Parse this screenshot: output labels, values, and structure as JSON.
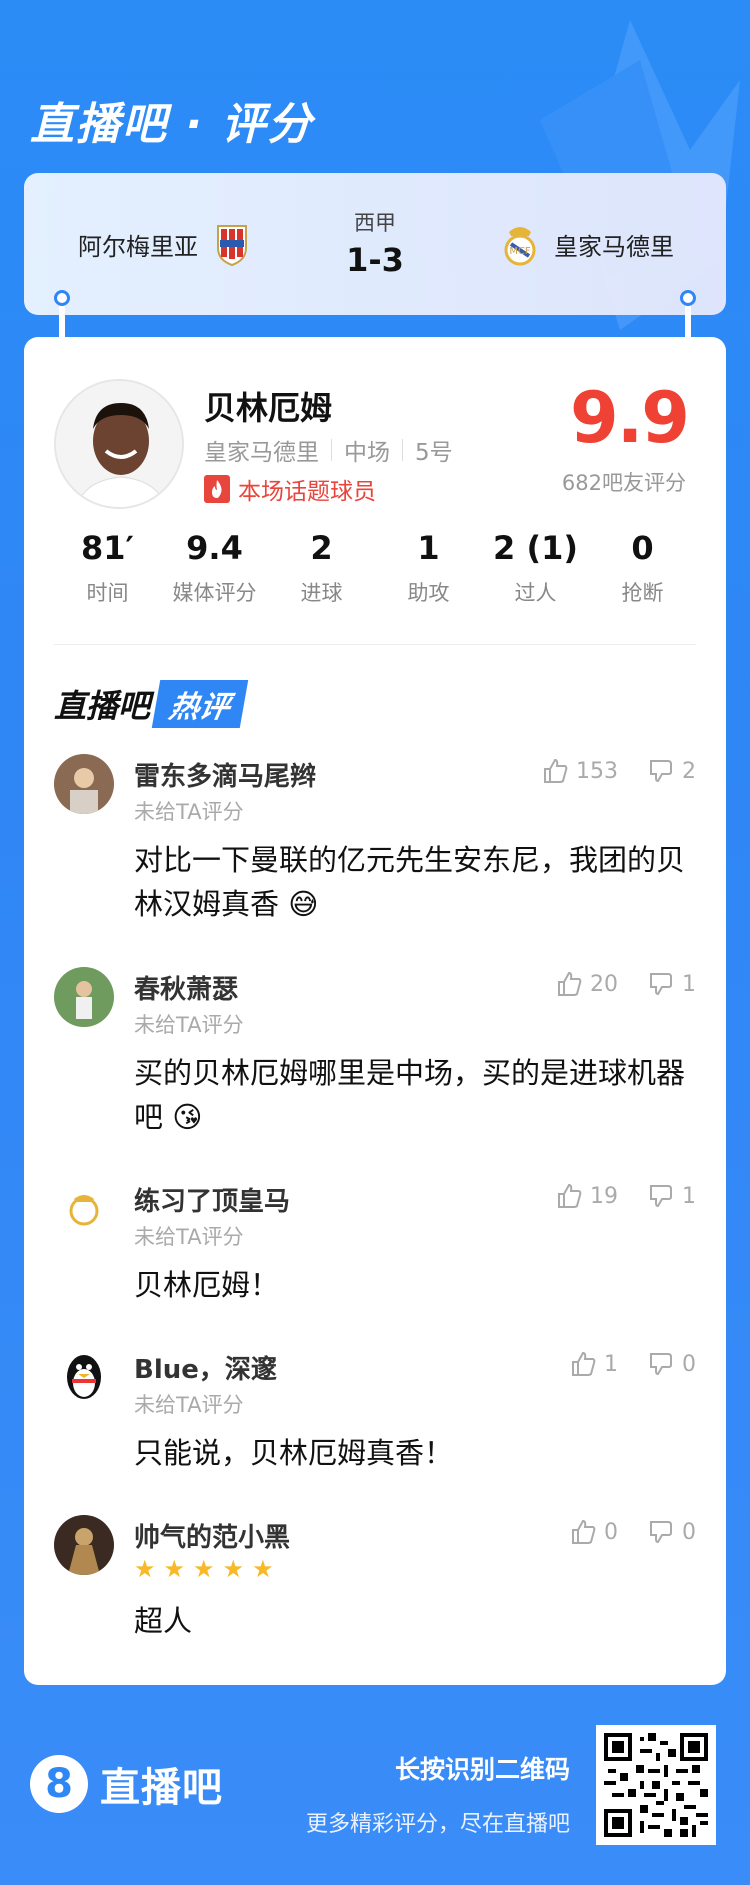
{
  "header": {
    "title": "直播吧 · 评分"
  },
  "match": {
    "home_team": "阿尔梅里亚",
    "away_team": "皇家马德里",
    "league": "西甲",
    "score": "1-3"
  },
  "player": {
    "name": "贝林厄姆",
    "team": "皇家马德里",
    "position": "中场",
    "number": "5号",
    "hot_tag": "本场话题球员",
    "rating": "9.9",
    "rating_count": "682吧友评分"
  },
  "stats": [
    {
      "value": "81′",
      "label": "时间"
    },
    {
      "value": "9.4",
      "label": "媒体评分"
    },
    {
      "value": "2",
      "label": "进球"
    },
    {
      "value": "1",
      "label": "助攻"
    },
    {
      "value": "2 (1)",
      "label": "过人"
    },
    {
      "value": "0",
      "label": "抢断"
    }
  ],
  "hot_section": {
    "title_a": "直播吧",
    "title_b": "热评"
  },
  "comments": [
    {
      "user": "雷东多滴马尾辫",
      "sub": "未给TA评分",
      "text": "对比一下曼联的亿元先生安东尼，我团的贝林汉姆真香",
      "likes": "153",
      "dislikes": "2"
    },
    {
      "user": "春秋萧瑟",
      "sub": "未给TA评分",
      "text": "买的贝林厄姆哪里是中场，买的是进球机器吧",
      "likes": "20",
      "dislikes": "1"
    },
    {
      "user": "练习了顶皇马",
      "sub": "未给TA评分",
      "text": "贝林厄姆！",
      "likes": "19",
      "dislikes": "1"
    },
    {
      "user": "Blue，深邃",
      "sub": "未给TA评分",
      "text": "只能说，贝林厄姆真香！",
      "likes": "1",
      "dislikes": "0"
    },
    {
      "user": "帅气的范小黑",
      "stars": 5,
      "text": "超人",
      "likes": "0",
      "dislikes": "0"
    }
  ],
  "footer": {
    "logo_num": "8",
    "logo_text": "直播吧",
    "line1": "长按识别二维码",
    "line2": "更多精彩评分，尽在直播吧"
  },
  "colors": {
    "brand_blue": "#2f86f5",
    "rating_red": "#ef4134",
    "star": "#f7b928"
  }
}
